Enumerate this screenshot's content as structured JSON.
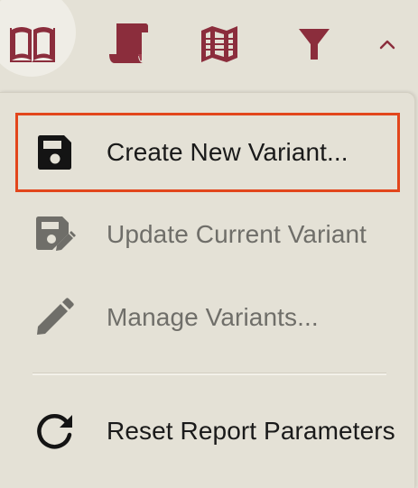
{
  "toolbar": {
    "buttons": [
      {
        "icon": "book-open-icon",
        "active": true
      },
      {
        "icon": "scroll-icon",
        "active": false
      },
      {
        "icon": "map-icon",
        "active": false
      },
      {
        "icon": "filter-icon",
        "active": false
      },
      {
        "icon": "chevron-up-icon",
        "active": false
      }
    ],
    "accent_color": "#8b2d3c"
  },
  "menu": {
    "items": [
      {
        "label": "Create New Variant...",
        "icon": "save-icon",
        "enabled": true,
        "focused": true
      },
      {
        "label": "Update Current Variant",
        "icon": "save-edit-icon",
        "enabled": false
      },
      {
        "label": "Manage Variants...",
        "icon": "pencil-icon",
        "enabled": false
      },
      {
        "label": "Reset Report Parameters",
        "icon": "refresh-icon",
        "enabled": true
      }
    ],
    "focus_color": "#e2461c"
  }
}
